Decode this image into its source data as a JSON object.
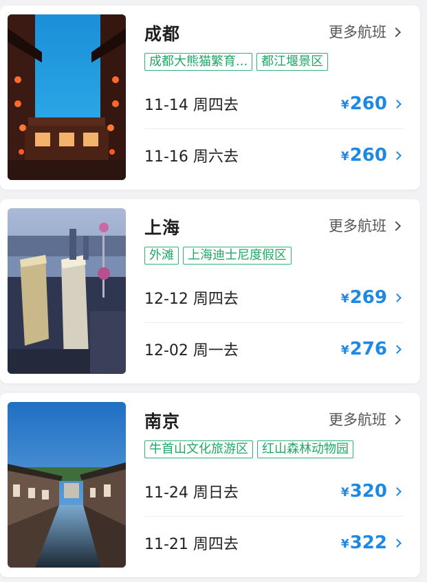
{
  "currency_symbol": "¥",
  "more_label": "更多航班",
  "destinations": [
    {
      "city": "成都",
      "image_icon": "chengdu-kuanzhai-alley-photo",
      "tags": [
        "成都大熊猫繁育...",
        "都江堰景区"
      ],
      "flights": [
        {
          "date": "11-14 周四去",
          "price": "260"
        },
        {
          "date": "11-16 周六去",
          "price": "260"
        }
      ]
    },
    {
      "city": "上海",
      "image_icon": "shanghai-skyline-photo",
      "tags": [
        "外滩",
        "上海迪士尼度假区"
      ],
      "flights": [
        {
          "date": "12-12 周四去",
          "price": "269"
        },
        {
          "date": "12-02 周一去",
          "price": "276"
        }
      ]
    },
    {
      "city": "南京",
      "image_icon": "nanjing-water-town-photo",
      "tags": [
        "牛首山文化旅游区",
        "红山森林动物园"
      ],
      "flights": [
        {
          "date": "11-24 周日去",
          "price": "320"
        },
        {
          "date": "11-21 周四去",
          "price": "322"
        }
      ]
    }
  ]
}
